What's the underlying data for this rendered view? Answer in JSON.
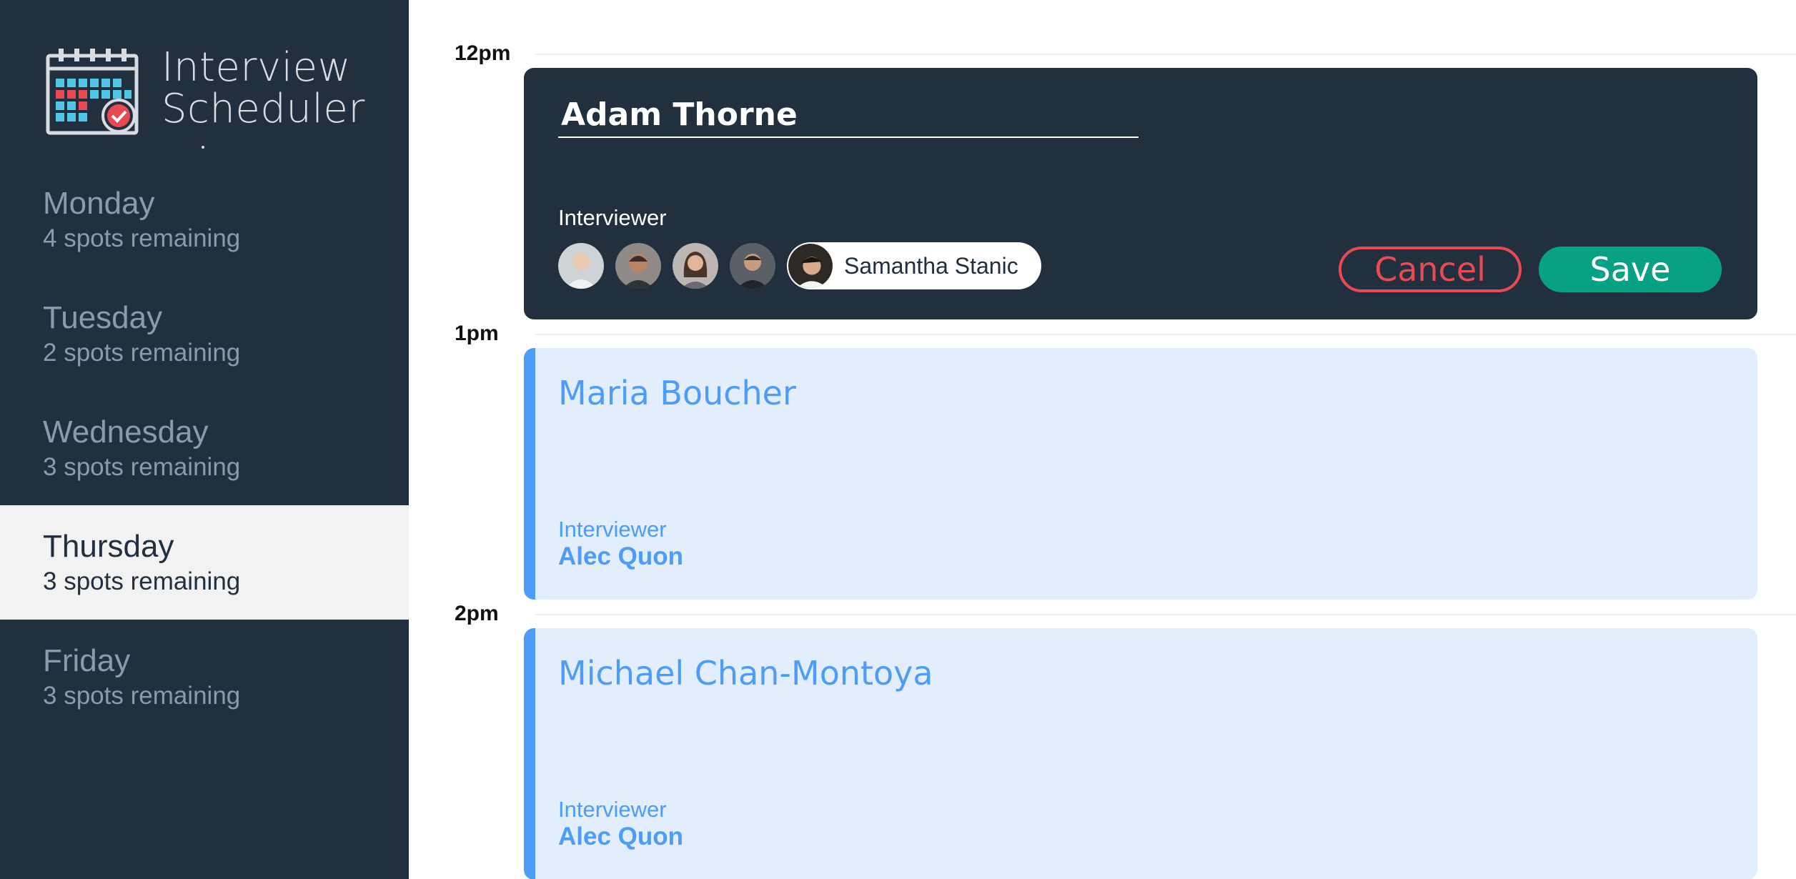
{
  "app": {
    "title_line1": "Interview",
    "title_line2": "Scheduler"
  },
  "sidebar": {
    "days": [
      {
        "name": "Monday",
        "spots": "4 spots remaining",
        "selected": false
      },
      {
        "name": "Tuesday",
        "spots": "2 spots remaining",
        "selected": false
      },
      {
        "name": "Wednesday",
        "spots": "3 spots remaining",
        "selected": false
      },
      {
        "name": "Thursday",
        "spots": "3 spots remaining",
        "selected": true
      },
      {
        "name": "Friday",
        "spots": "3 spots remaining",
        "selected": false
      }
    ]
  },
  "schedule": {
    "times": [
      "12pm",
      "1pm",
      "2pm"
    ],
    "form": {
      "student_name": "Adam Thorne",
      "interviewer_label": "Interviewer",
      "interviewers": [
        {
          "icon": "avatar-1-icon"
        },
        {
          "icon": "avatar-2-icon"
        },
        {
          "icon": "avatar-3-icon"
        },
        {
          "icon": "avatar-4-icon"
        }
      ],
      "selected_interviewer": "Samantha Stanic",
      "cancel_label": "Cancel",
      "save_label": "Save"
    },
    "appointments": [
      {
        "student": "Maria Boucher",
        "interviewer_label": "Interviewer",
        "interviewer": "Alec Quon"
      },
      {
        "student": "Michael Chan-Montoya",
        "interviewer_label": "Interviewer",
        "interviewer": "Alec Quon"
      }
    ]
  },
  "colors": {
    "sidebar_bg": "#222f3e",
    "selected_day_bg": "#f2f2f2",
    "cancel": "#e84a52",
    "save": "#08a183",
    "appointment_bg": "#e3eefd",
    "appointment_accent": "#4d9cf7"
  }
}
